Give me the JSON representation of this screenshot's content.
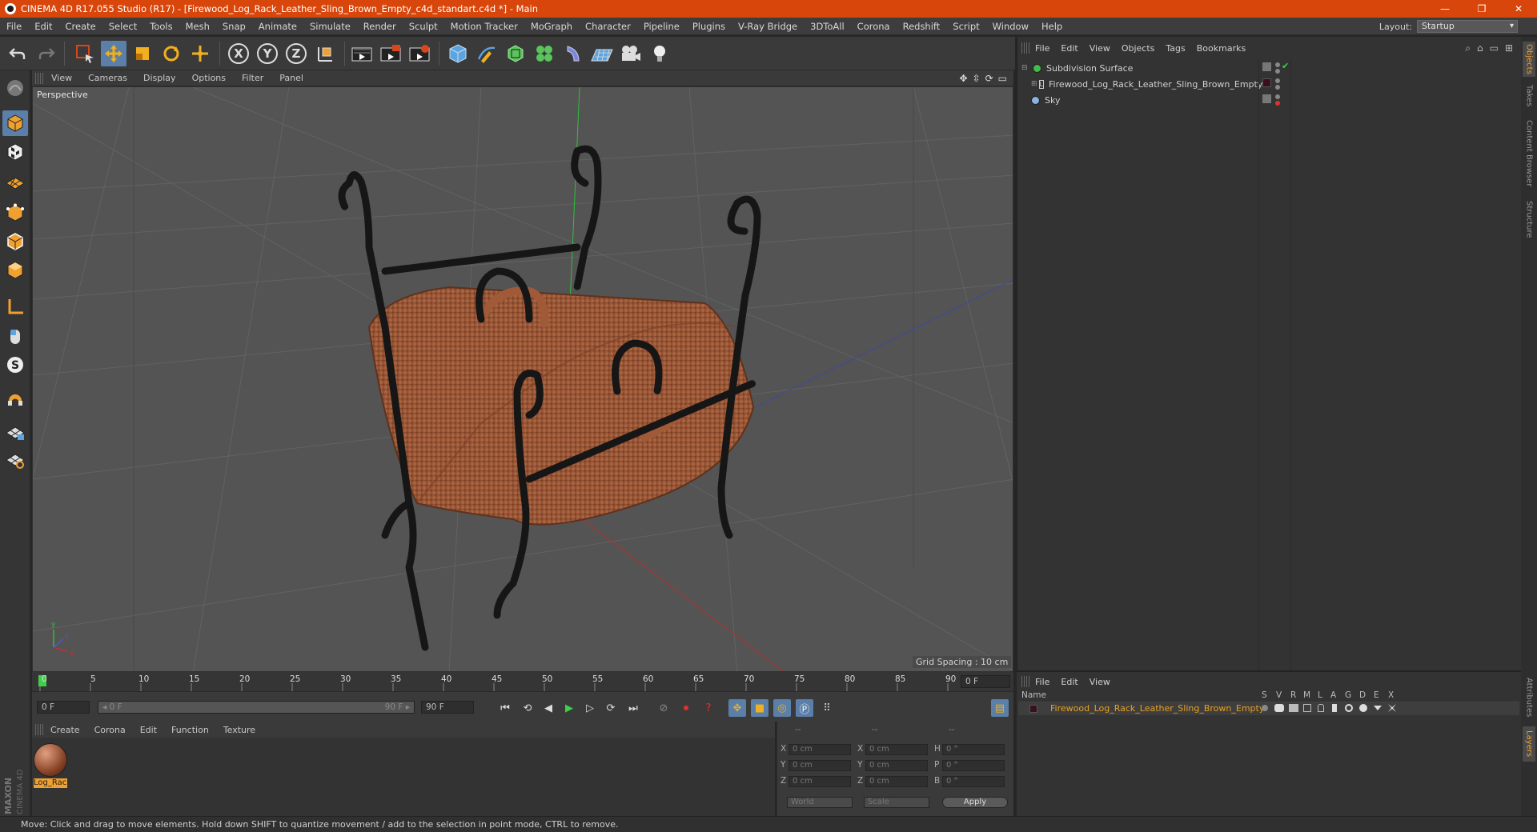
{
  "window": {
    "title": "CINEMA 4D R17.055 Studio (R17) - [Firewood_Log_Rack_Leather_Sling_Brown_Empty_c4d_standart.c4d *] - Main",
    "controls": [
      "—",
      "❐",
      "✕"
    ]
  },
  "menubar": {
    "items": [
      "File",
      "Edit",
      "Create",
      "Select",
      "Tools",
      "Mesh",
      "Snap",
      "Animate",
      "Simulate",
      "Render",
      "Sculpt",
      "Motion Tracker",
      "MoGraph",
      "Character",
      "Pipeline",
      "Plugins",
      "V-Ray Bridge",
      "3DToAll",
      "Corona",
      "Redshift",
      "Script",
      "Window",
      "Help"
    ],
    "layout_label": "Layout:",
    "layout_value": "Startup"
  },
  "toolbar": {
    "axis_labels": [
      "X",
      "Y",
      "Z"
    ]
  },
  "viewport": {
    "menu": [
      "View",
      "Cameras",
      "Display",
      "Options",
      "Filter",
      "Panel"
    ],
    "label": "Perspective",
    "grid_spacing": "Grid Spacing : 10 cm",
    "nav_icons": [
      "✥",
      "⇳",
      "⟳",
      "▭"
    ]
  },
  "timeline": {
    "ticks": [
      "0",
      "5",
      "10",
      "15",
      "20",
      "25",
      "30",
      "35",
      "40",
      "45",
      "50",
      "55",
      "60",
      "65",
      "70",
      "75",
      "80",
      "85",
      "90"
    ],
    "current_frame": "0 F"
  },
  "transport": {
    "start_field": "0 F",
    "range_start": "◂ 0 F",
    "range_end": "90 F ▸",
    "end_field": "90 F"
  },
  "material_manager": {
    "menu": [
      "Create",
      "Corona",
      "Edit",
      "Function",
      "Texture"
    ],
    "material_name": "Log_Rac"
  },
  "coordinates": {
    "headers": [
      "--",
      "--",
      "--"
    ],
    "rows": [
      {
        "a": "X",
        "av": "0 cm",
        "b": "X",
        "bv": "0 cm",
        "c": "H",
        "cv": "0 °"
      },
      {
        "a": "Y",
        "av": "0 cm",
        "b": "Y",
        "bv": "0 cm",
        "c": "P",
        "cv": "0 °"
      },
      {
        "a": "Z",
        "av": "0 cm",
        "b": "Z",
        "bv": "0 cm",
        "c": "B",
        "cv": "0 °"
      }
    ],
    "mode1": "World",
    "mode2": "Scale",
    "apply": "Apply"
  },
  "object_manager": {
    "menu": [
      "File",
      "Edit",
      "View",
      "Objects",
      "Tags",
      "Bookmarks"
    ],
    "objects": [
      "Subdivision Surface",
      "Firewood_Log_Rack_Leather_Sling_Brown_Empty",
      "Sky"
    ]
  },
  "layer_manager": {
    "menu": [
      "File",
      "Edit",
      "View"
    ],
    "name_col": "Name",
    "cols": [
      "S",
      "V",
      "R",
      "M",
      "L",
      "A",
      "G",
      "D",
      "E",
      "X"
    ],
    "layer_name": "Firewood_Log_Rack_Leather_Sling_Brown_Empty"
  },
  "right_tabs": [
    "Objects",
    "Takes",
    "Content Browser",
    "Structure"
  ],
  "right_tabs_lower": [
    "Attributes",
    "Layers"
  ],
  "status": "Move: Click and drag to move elements. Hold down SHIFT to quantize movement / add to the selection in point mode, CTRL to remove.",
  "colors": {
    "accent": "#d8460b",
    "active": "#5a7fa8",
    "layer": "#e8a020"
  }
}
